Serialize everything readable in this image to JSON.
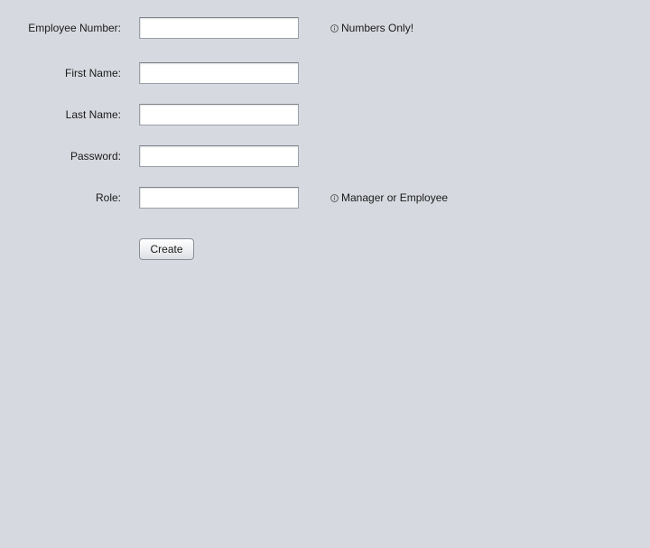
{
  "form": {
    "employee_number": {
      "label": "Employee Number:",
      "value": "",
      "hint": "Numbers Only!"
    },
    "first_name": {
      "label": "First Name:",
      "value": ""
    },
    "last_name": {
      "label": "Last Name:",
      "value": ""
    },
    "password": {
      "label": "Password:",
      "value": ""
    },
    "role": {
      "label": "Role:",
      "value": "",
      "hint": "Manager or Employee"
    },
    "create_label": "Create"
  },
  "icons": {
    "hint_icon": "info-icon"
  },
  "colors": {
    "background": "#d6d9df",
    "field_background": "#ffffff",
    "field_border": "#9aa0a8"
  }
}
